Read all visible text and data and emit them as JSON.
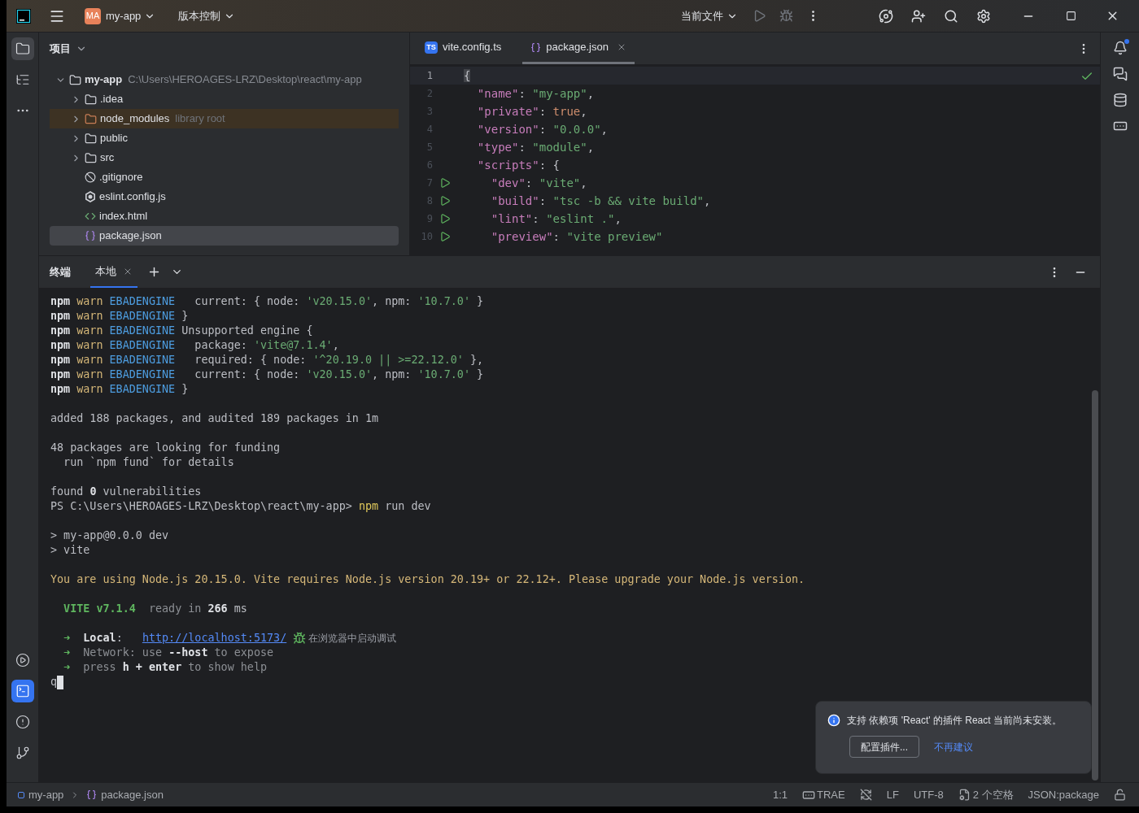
{
  "titlebar": {
    "app_badge": "MA",
    "project": "my-app",
    "vcs": "版本控制",
    "run_config": "当前文件"
  },
  "left_toolbar": [
    {
      "kind": "project",
      "selected": true
    },
    {
      "kind": "structure",
      "selected": false
    },
    {
      "kind": "more",
      "selected": false
    }
  ],
  "left_toolbar_bottom": [
    {
      "kind": "services",
      "selected": false
    },
    {
      "kind": "terminal",
      "selected": true
    },
    {
      "kind": "problems",
      "selected": false
    },
    {
      "kind": "git",
      "selected": false
    }
  ],
  "right_toolbar": [
    {
      "kind": "notifications",
      "badge": true
    },
    {
      "kind": "ai-chat",
      "badge": false
    },
    {
      "kind": "database",
      "badge": false
    },
    {
      "kind": "remote",
      "badge": false
    }
  ],
  "project_panel": {
    "title": "项目",
    "tree": [
      {
        "name": "my-app",
        "path": "C:\\Users\\HEROAGES-LRZ\\Desktop\\react\\my-app",
        "kind": "folder",
        "expanded": true,
        "selected": false,
        "children": [
          {
            "name": ".idea",
            "kind": "folder",
            "expanded": false,
            "selected": false
          },
          {
            "name": "node_modules",
            "note": "library root",
            "kind": "library",
            "expanded": false,
            "selected": false
          },
          {
            "name": "public",
            "kind": "folder",
            "expanded": false,
            "selected": false
          },
          {
            "name": "src",
            "kind": "folder",
            "expanded": false,
            "selected": false
          },
          {
            "name": ".gitignore",
            "kind": "ignore",
            "selected": false
          },
          {
            "name": "eslint.config.js",
            "kind": "eslint",
            "selected": false
          },
          {
            "name": "index.html",
            "kind": "html",
            "selected": false
          },
          {
            "name": "package.json",
            "kind": "json",
            "selected": true
          }
        ]
      }
    ]
  },
  "editor": {
    "tabs": [
      {
        "label": "vite.config.ts",
        "kind": "ts",
        "icon_text": "TS",
        "selected": false
      },
      {
        "label": "package.json",
        "kind": "json",
        "selected": true
      }
    ],
    "lines": [
      {
        "number": "1",
        "runnable": false,
        "current": true,
        "segments": [
          {
            "text": "{",
            "kind": "punct"
          }
        ]
      },
      {
        "number": "2",
        "runnable": false,
        "current": false,
        "segments": [
          {
            "text": "  \"name\"",
            "kind": "key"
          },
          {
            "text": ": ",
            "kind": "punct"
          },
          {
            "text": "\"my-app\"",
            "kind": "string"
          },
          {
            "text": ",",
            "kind": "punct"
          }
        ]
      },
      {
        "number": "3",
        "runnable": false,
        "current": false,
        "segments": [
          {
            "text": "  \"private\"",
            "kind": "key"
          },
          {
            "text": ": ",
            "kind": "punct"
          },
          {
            "text": "true",
            "kind": "bool"
          },
          {
            "text": ",",
            "kind": "punct"
          }
        ]
      },
      {
        "number": "4",
        "runnable": false,
        "current": false,
        "segments": [
          {
            "text": "  \"version\"",
            "kind": "key"
          },
          {
            "text": ": ",
            "kind": "punct"
          },
          {
            "text": "\"0.0.0\"",
            "kind": "string"
          },
          {
            "text": ",",
            "kind": "punct"
          }
        ]
      },
      {
        "number": "5",
        "runnable": false,
        "current": false,
        "segments": [
          {
            "text": "  \"type\"",
            "kind": "key"
          },
          {
            "text": ": ",
            "kind": "punct"
          },
          {
            "text": "\"module\"",
            "kind": "string"
          },
          {
            "text": ",",
            "kind": "punct"
          }
        ]
      },
      {
        "number": "6",
        "runnable": false,
        "current": false,
        "segments": [
          {
            "text": "  \"scripts\"",
            "kind": "key"
          },
          {
            "text": ": {",
            "kind": "punct"
          }
        ]
      },
      {
        "number": "7",
        "runnable": true,
        "current": false,
        "segments": [
          {
            "text": "    \"dev\"",
            "kind": "key"
          },
          {
            "text": ": ",
            "kind": "punct"
          },
          {
            "text": "\"vite\"",
            "kind": "string"
          },
          {
            "text": ",",
            "kind": "punct"
          }
        ]
      },
      {
        "number": "8",
        "runnable": true,
        "current": false,
        "segments": [
          {
            "text": "    \"build\"",
            "kind": "key"
          },
          {
            "text": ": ",
            "kind": "punct"
          },
          {
            "text": "\"tsc -b && vite build\"",
            "kind": "string"
          },
          {
            "text": ",",
            "kind": "punct"
          }
        ]
      },
      {
        "number": "9",
        "runnable": true,
        "current": false,
        "segments": [
          {
            "text": "    \"lint\"",
            "kind": "key"
          },
          {
            "text": ": ",
            "kind": "punct"
          },
          {
            "text": "\"eslint .\"",
            "kind": "string"
          },
          {
            "text": ",",
            "kind": "punct"
          }
        ]
      },
      {
        "number": "10",
        "runnable": true,
        "current": false,
        "segments": [
          {
            "text": "    \"preview\"",
            "kind": "key"
          },
          {
            "text": ": ",
            "kind": "punct"
          },
          {
            "text": "\"vite preview\"",
            "kind": "string"
          }
        ]
      }
    ]
  },
  "terminal": {
    "title": "终端",
    "tabs": [
      {
        "label": "本地",
        "selected": true
      }
    ],
    "cursor": true,
    "lines": [
      {
        "blank_before": false,
        "segments": [
          {
            "text": "npm",
            "kind": "bold"
          },
          {
            "text": " warn",
            "kind": "warn"
          },
          {
            "text": " EBADENGINE",
            "kind": "info"
          },
          {
            "text": "   current: { node: ",
            "kind": "plain"
          },
          {
            "text": "'v20.15.0'",
            "kind": "string"
          },
          {
            "text": ", npm: ",
            "kind": "plain"
          },
          {
            "text": "'10.7.0'",
            "kind": "string"
          },
          {
            "text": " }",
            "kind": "plain"
          }
        ]
      },
      {
        "blank_before": false,
        "segments": [
          {
            "text": "npm",
            "kind": "bold"
          },
          {
            "text": " warn",
            "kind": "warn"
          },
          {
            "text": " EBADENGINE",
            "kind": "info"
          },
          {
            "text": " }",
            "kind": "plain"
          }
        ]
      },
      {
        "blank_before": false,
        "segments": [
          {
            "text": "npm",
            "kind": "bold"
          },
          {
            "text": " warn",
            "kind": "warn"
          },
          {
            "text": " EBADENGINE",
            "kind": "info"
          },
          {
            "text": " Unsupported engine {",
            "kind": "plain"
          }
        ]
      },
      {
        "blank_before": false,
        "segments": [
          {
            "text": "npm",
            "kind": "bold"
          },
          {
            "text": " warn",
            "kind": "warn"
          },
          {
            "text": " EBADENGINE",
            "kind": "info"
          },
          {
            "text": "   package: ",
            "kind": "plain"
          },
          {
            "text": "'vite@7.1.4'",
            "kind": "string"
          },
          {
            "text": ",",
            "kind": "plain"
          }
        ]
      },
      {
        "blank_before": false,
        "segments": [
          {
            "text": "npm",
            "kind": "bold"
          },
          {
            "text": " warn",
            "kind": "warn"
          },
          {
            "text": " EBADENGINE",
            "kind": "info"
          },
          {
            "text": "   required: { node: ",
            "kind": "plain"
          },
          {
            "text": "'^20.19.0 || >=22.12.0'",
            "kind": "string"
          },
          {
            "text": " },",
            "kind": "plain"
          }
        ]
      },
      {
        "blank_before": false,
        "segments": [
          {
            "text": "npm",
            "kind": "bold"
          },
          {
            "text": " warn",
            "kind": "warn"
          },
          {
            "text": " EBADENGINE",
            "kind": "info"
          },
          {
            "text": "   current: { node: ",
            "kind": "plain"
          },
          {
            "text": "'v20.15.0'",
            "kind": "string"
          },
          {
            "text": ", npm: ",
            "kind": "plain"
          },
          {
            "text": "'10.7.0'",
            "kind": "string"
          },
          {
            "text": " }",
            "kind": "plain"
          }
        ]
      },
      {
        "blank_before": false,
        "segments": [
          {
            "text": "npm",
            "kind": "bold"
          },
          {
            "text": " warn",
            "kind": "warn"
          },
          {
            "text": " EBADENGINE",
            "kind": "info"
          },
          {
            "text": " }",
            "kind": "plain"
          }
        ]
      },
      {
        "blank_before": true,
        "segments": [
          {
            "text": "added 188 packages, and audited 189 packages in 1m",
            "kind": "plain"
          }
        ]
      },
      {
        "blank_before": true,
        "segments": [
          {
            "text": "48 packages are looking for funding",
            "kind": "plain"
          }
        ]
      },
      {
        "blank_before": false,
        "segments": [
          {
            "text": "  run `npm fund` for details",
            "kind": "plain"
          }
        ]
      },
      {
        "blank_before": true,
        "segments": [
          {
            "text": "found ",
            "kind": "plain"
          },
          {
            "text": "0",
            "kind": "bold"
          },
          {
            "text": " vulnerabilities",
            "kind": "plain"
          }
        ]
      },
      {
        "blank_before": false,
        "segments": [
          {
            "text": "PS C:\\Users\\HEROAGES-LRZ\\Desktop\\react\\my-app> ",
            "kind": "plain"
          },
          {
            "text": "npm",
            "kind": "command"
          },
          {
            "text": " run dev",
            "kind": "plain"
          }
        ]
      },
      {
        "blank_before": true,
        "segments": [
          {
            "text": "> my-app@0.0.0 dev",
            "kind": "plain"
          }
        ]
      },
      {
        "blank_before": false,
        "segments": [
          {
            "text": "> vite",
            "kind": "plain"
          }
        ]
      },
      {
        "blank_before": true,
        "segments": [
          {
            "text": "You are using Node.js 20.15.0. Vite requires Node.js version 20.19+ or 22.12+. Please upgrade your Node.js version.",
            "kind": "message"
          }
        ]
      },
      {
        "blank_before": true,
        "segments": [
          {
            "text": "  VITE v7.1.4",
            "kind": "vite"
          },
          {
            "text": "  ready in ",
            "kind": "dim"
          },
          {
            "text": "266",
            "kind": "bold"
          },
          {
            "text": " ms",
            "kind": "plain"
          }
        ]
      },
      {
        "blank_before": true,
        "segments": [
          {
            "text": "  ➜",
            "kind": "arrow"
          },
          {
            "text": "  Local",
            "kind": "bold"
          },
          {
            "text": ":   ",
            "kind": "plain"
          },
          {
            "text": "http://localhost:5173/",
            "kind": "link"
          },
          {
            "text": "在浏览器中启动调试",
            "kind": "action"
          }
        ]
      },
      {
        "blank_before": false,
        "segments": [
          {
            "text": "  ➜",
            "kind": "arrow"
          },
          {
            "text": "  Network",
            "kind": "dim"
          },
          {
            "text": ": use ",
            "kind": "dim"
          },
          {
            "text": "--host",
            "kind": "bold"
          },
          {
            "text": " to expose",
            "kind": "dim"
          }
        ]
      },
      {
        "blank_before": false,
        "segments": [
          {
            "text": "  ➜",
            "kind": "arrow"
          },
          {
            "text": "  press ",
            "kind": "dim"
          },
          {
            "text": "h + enter",
            "kind": "bold"
          },
          {
            "text": " to show help",
            "kind": "dim"
          }
        ]
      },
      {
        "blank_before": false,
        "segments": [
          {
            "text": "q",
            "kind": "plain"
          }
        ]
      }
    ]
  },
  "notification": {
    "message": "支持 依赖项 'React' 的插件 React 当前尚未安装。",
    "primary": "配置插件...",
    "secondary": "不再建议"
  },
  "status_bar": {
    "breadcrumbs": [
      {
        "label": "my-app",
        "kind": "module"
      },
      {
        "label": "package.json",
        "kind": "json"
      }
    ],
    "items": [
      {
        "label": "1:1",
        "kind": "text"
      },
      {
        "label": "TRAE",
        "kind": "trae"
      },
      {
        "kind": "no-sync"
      },
      {
        "label": "LF",
        "kind": "text"
      },
      {
        "label": "UTF-8",
        "kind": "text"
      },
      {
        "label": "2 个空格",
        "kind": "indent"
      },
      {
        "label": "JSON:package",
        "kind": "text"
      },
      {
        "kind": "lock"
      }
    ]
  }
}
